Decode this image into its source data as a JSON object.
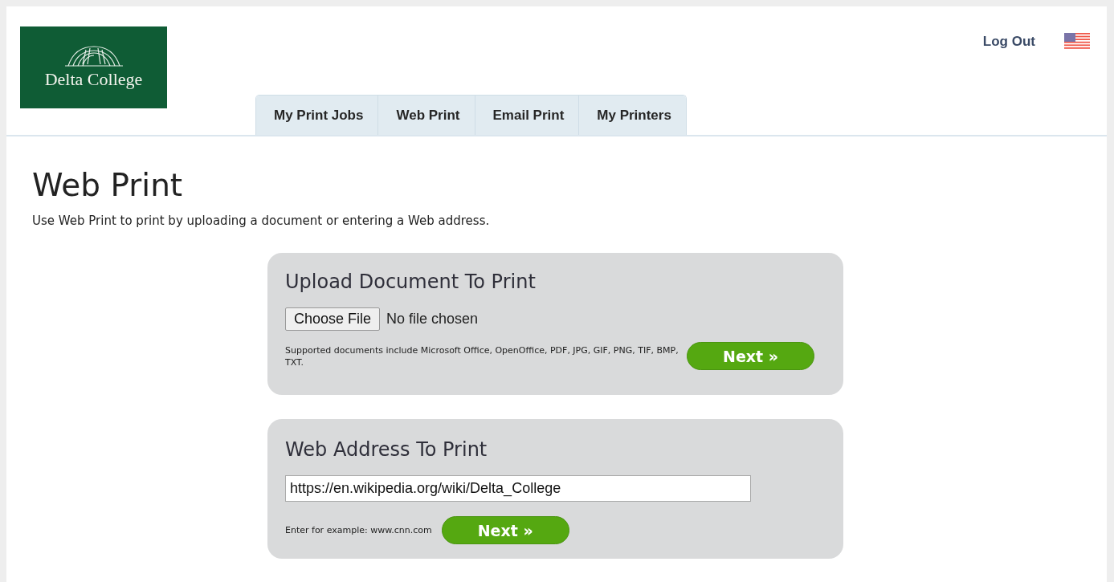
{
  "header": {
    "logo_text": "Delta College",
    "logout": "Log Out"
  },
  "tabs": [
    {
      "label": "My Print Jobs",
      "selected": false
    },
    {
      "label": "Web Print",
      "selected": false
    },
    {
      "label": "Email Print",
      "selected": false
    },
    {
      "label": "My Printers",
      "selected": false
    }
  ],
  "page": {
    "title": "Web Print",
    "description": "Use Web Print to print by uploading a document or entering a Web address."
  },
  "upload_panel": {
    "title": "Upload Document To Print",
    "file_button": "Choose File",
    "file_status": "No file chosen",
    "note": "Supported documents include Microsoft Office, OpenOffice, PDF, JPG, GIF, PNG, TIF, BMP, TXT.",
    "button": "Next »"
  },
  "address_panel": {
    "title": "Web Address To Print",
    "value": "https://en.wikipedia.org/wiki/Delta_College",
    "note": "Enter for example: www.cnn.com",
    "button": "Next »"
  }
}
